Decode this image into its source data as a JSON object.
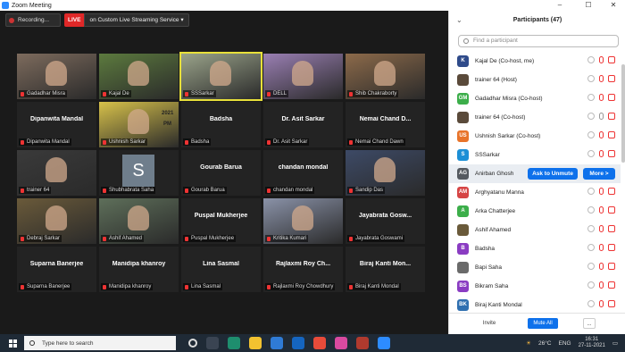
{
  "window": {
    "title": "Zoom Meeting",
    "controls": [
      "–",
      "☐",
      "✕"
    ]
  },
  "toolbar": {
    "recording": "Recording...",
    "live_badge": "LIVE",
    "live_service": "on Custom Live Streaming Service"
  },
  "tiles": [
    {
      "label": "Gadadhar Misra",
      "big": "",
      "kind": "photo",
      "color": "#7d6b5d"
    },
    {
      "label": "Kajal De",
      "big": "",
      "kind": "photo",
      "color": "#5c7a3e"
    },
    {
      "label": "SSSarkar",
      "big": "",
      "kind": "photo",
      "color": "#9aa38a",
      "active": true
    },
    {
      "label": "DELL",
      "big": "",
      "kind": "photo",
      "color": "#9a7fb3"
    },
    {
      "label": "Shib Chakraborty",
      "big": "",
      "kind": "photo",
      "color": "#8c6a4a"
    },
    {
      "label": "Dipanwita Mandal",
      "big": "Dipanwita Mandal",
      "kind": "name"
    },
    {
      "label": "Ushnish Sarkar",
      "big": "",
      "kind": "photo",
      "color": "#d7c14a"
    },
    {
      "label": "Badsha",
      "big": "Badsha",
      "kind": "name"
    },
    {
      "label": "Dr. Asit Sarkar",
      "big": "Dr. Asit Sarkar",
      "kind": "name"
    },
    {
      "label": "Nemai Chand Dawn",
      "big": "Nemai Chand D...",
      "kind": "name"
    },
    {
      "label": "trainer 64",
      "big": "",
      "kind": "photo",
      "color": "#3a3a3a"
    },
    {
      "label": "Shubhabrata Saha",
      "big": "",
      "kind": "avatar",
      "initial": "S"
    },
    {
      "label": "Gourab Barua",
      "big": "Gourab Barua",
      "kind": "name"
    },
    {
      "label": "chandan mondal",
      "big": "chandan mondal",
      "kind": "name"
    },
    {
      "label": "Sandip Das",
      "big": "",
      "kind": "photo",
      "color": "#3d4a66"
    },
    {
      "label": "Debraj Sarkar",
      "big": "",
      "kind": "photo",
      "color": "#6a5a3a"
    },
    {
      "label": "Ashif Ahamed",
      "big": "",
      "kind": "photo",
      "color": "#5e6f5a"
    },
    {
      "label": "Puspal Mukherjee",
      "big": "Puspal Mukherjee",
      "kind": "name"
    },
    {
      "label": "Kritika Kumari",
      "big": "",
      "kind": "photo",
      "color": "#8a92a8"
    },
    {
      "label": "Jayabrata Goswami",
      "big": "Jayabrata Gosw...",
      "kind": "name"
    },
    {
      "label": "Suparna Banerjee",
      "big": "Suparna Banerjee",
      "kind": "name"
    },
    {
      "label": "Manidipa khanroy",
      "big": "Manidipa khanroy",
      "kind": "name"
    },
    {
      "label": "Lina Sasmal",
      "big": "Lina Sasmal",
      "kind": "name"
    },
    {
      "label": "Rajlaxmi Roy Chowdhury",
      "big": "Rajlaxmi Roy Ch...",
      "kind": "name"
    },
    {
      "label": "Biraj Kanti Mondal",
      "big": "Biraj Kanti Mon...",
      "kind": "name"
    }
  ],
  "ushnish_overlay": {
    "line1": "2021",
    "line2": "PM"
  },
  "participants_panel": {
    "title": "Participants (47)",
    "search_placeholder": "Find a participant",
    "items": [
      {
        "name": "Kajal De (Co-host, me)",
        "initials": "K",
        "color": "#2f4b8a",
        "mic": "muted",
        "cam": "off"
      },
      {
        "name": "trainer 64 (Host)",
        "initials": "",
        "color": "#5a4a3a",
        "mic": "muted",
        "cam": "off"
      },
      {
        "name": "Gadadhar Misra (Co-host)",
        "initials": "GM",
        "color": "#3cae4a",
        "mic": "muted",
        "cam": "off"
      },
      {
        "name": "trainer 64 (Co-host)",
        "initials": "",
        "color": "#5a4a3a",
        "mic": "on",
        "cam": "off"
      },
      {
        "name": "Ushnish Sarkar (Co-host)",
        "initials": "US",
        "color": "#e8742a",
        "mic": "muted",
        "cam": "off"
      },
      {
        "name": "SSSarkar",
        "initials": "S",
        "color": "#1c8fd6",
        "mic": "muted",
        "cam": "off"
      },
      {
        "name": "Anirban Ghosh",
        "initials": "AG",
        "color": "#555a60",
        "highlight": true
      },
      {
        "name": "Arghyatanu Manna",
        "initials": "AM",
        "color": "#d64545",
        "mic": "muted",
        "cam": "off"
      },
      {
        "name": "Arka Chatterjee",
        "initials": "A",
        "color": "#3cae4a",
        "mic": "muted",
        "cam": "off"
      },
      {
        "name": "Ashif Ahamed",
        "initials": "",
        "color": "#6a5a3a",
        "mic": "muted",
        "cam": "off"
      },
      {
        "name": "Badsha",
        "initials": "B",
        "color": "#8a3cc2",
        "mic": "muted",
        "cam": "off"
      },
      {
        "name": "Bapi Saha",
        "initials": "",
        "color": "#6a6a6a",
        "mic": "muted",
        "cam": "off"
      },
      {
        "name": "Bikram Saha",
        "initials": "BS",
        "color": "#8a3cc2",
        "mic": "muted",
        "cam": "off"
      },
      {
        "name": "Biraj Kanti Mondal",
        "initials": "BK",
        "color": "#2f6fb0",
        "mic": "muted",
        "cam": "off"
      }
    ],
    "ask_to_unmute": "Ask to Unmute",
    "more": "More >",
    "footer": {
      "invite": "Invite",
      "mute_all": "Mute All",
      "more": "..."
    }
  },
  "taskbar": {
    "search_placeholder": "Type here to search",
    "temperature": "26°C",
    "language": "ENG",
    "time": "16:31",
    "date": "27-11-2021"
  }
}
